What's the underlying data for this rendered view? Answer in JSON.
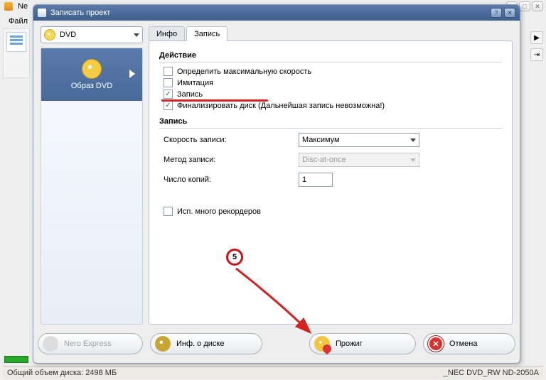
{
  "parent_window": {
    "title_fragment": "Ne",
    "menu_file": "Файл"
  },
  "dialog": {
    "title": "Записать проект"
  },
  "disc_select": {
    "label": "DVD"
  },
  "project_card": {
    "label": "Образ DVD"
  },
  "tabs": {
    "info": "Инфо",
    "record": "Запись"
  },
  "sections": {
    "action": "Действие",
    "record": "Запись"
  },
  "checks": {
    "detect_max_speed": "Определить максимальную скорость",
    "simulate": "Имитация",
    "record": "Запись",
    "finalize": "Финализировать диск (Дальнейшая запись невозможна!)",
    "multi_recorder": "Исп. много рекордеров"
  },
  "fields": {
    "speed_label": "Скорость записи:",
    "speed_value": "Максимум",
    "method_label": "Метод записи:",
    "method_value": "Disc-at-once",
    "copies_label": "Число копий:",
    "copies_value": "1"
  },
  "buttons": {
    "nero_express": "Nero Express",
    "disc_info": "Инф. о диске",
    "burn": "Прожиг",
    "cancel": "Отмена"
  },
  "status": {
    "left": "Общий объем диска: 2498 МБ",
    "right": "_NEC   DVD_RW ND-2050A"
  },
  "annotation": {
    "step": "5"
  }
}
